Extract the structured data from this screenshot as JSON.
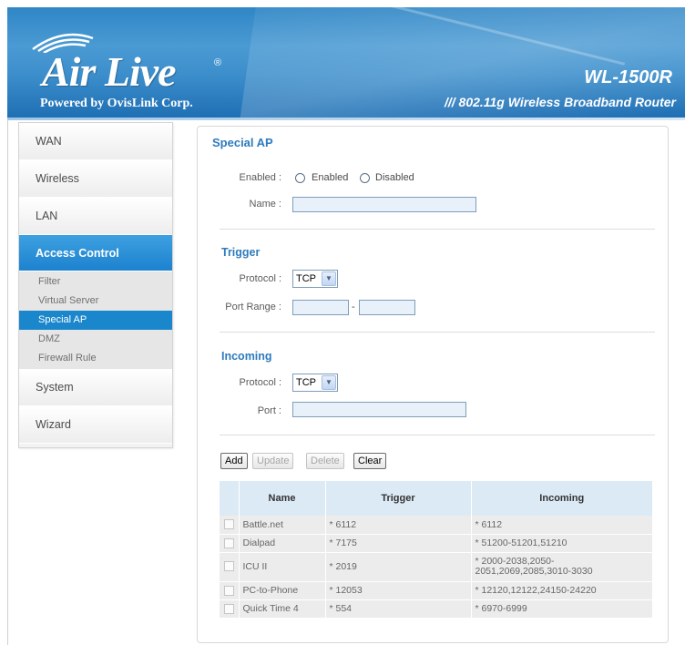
{
  "header": {
    "logo": "Air Live",
    "logo_mark": "®",
    "tagline": "Powered by OvisLink Corp.",
    "model": "WL-1500R",
    "model_desc": "/// 802.11g Wireless Broadband Router"
  },
  "sidebar": {
    "items": [
      {
        "label": "WAN"
      },
      {
        "label": "Wireless"
      },
      {
        "label": "LAN"
      },
      {
        "label": "Access Control"
      },
      {
        "label": "System"
      },
      {
        "label": "Wizard"
      }
    ],
    "sub_items": [
      {
        "label": "Filter"
      },
      {
        "label": "Virtual Server"
      },
      {
        "label": "Special AP"
      },
      {
        "label": "DMZ"
      },
      {
        "label": "Firewall Rule"
      }
    ]
  },
  "page": {
    "title": "Special AP",
    "enabled_label": "Enabled :",
    "enabled_option": "Enabled",
    "disabled_option": "Disabled",
    "name_label": "Name :",
    "name_value": "",
    "trigger": {
      "title": "Trigger",
      "protocol_label": "Protocol :",
      "protocol_value": "TCP",
      "port_range_label": "Port Range :",
      "port_from": "",
      "port_to": "",
      "dash": "-"
    },
    "incoming": {
      "title": "Incoming",
      "protocol_label": "Protocol :",
      "protocol_value": "TCP",
      "port_label": "Port :",
      "port_value": ""
    },
    "buttons": {
      "add": "Add",
      "update": "Update",
      "delete": "Delete",
      "clear": "Clear"
    },
    "table": {
      "headers": [
        "Name",
        "Trigger",
        "Incoming"
      ],
      "rows": [
        {
          "name": "Battle.net",
          "trigger": "* 6112",
          "incoming": "* 6112"
        },
        {
          "name": "Dialpad",
          "trigger": "* 7175",
          "incoming": "* 51200-51201,51210"
        },
        {
          "name": "ICU II",
          "trigger": "* 2019",
          "incoming": "* 2000-2038,2050-2051,2069,2085,3010-3030"
        },
        {
          "name": "PC-to-Phone",
          "trigger": "* 12053",
          "incoming": "* 12120,12122,24150-24220"
        },
        {
          "name": "Quick Time 4",
          "trigger": "* 554",
          "incoming": "* 6970-6999"
        }
      ]
    }
  },
  "colors": {
    "accent": "#2e7bbd",
    "nav_active": "#1d82cf",
    "header_bg": "#3d8fcc"
  }
}
